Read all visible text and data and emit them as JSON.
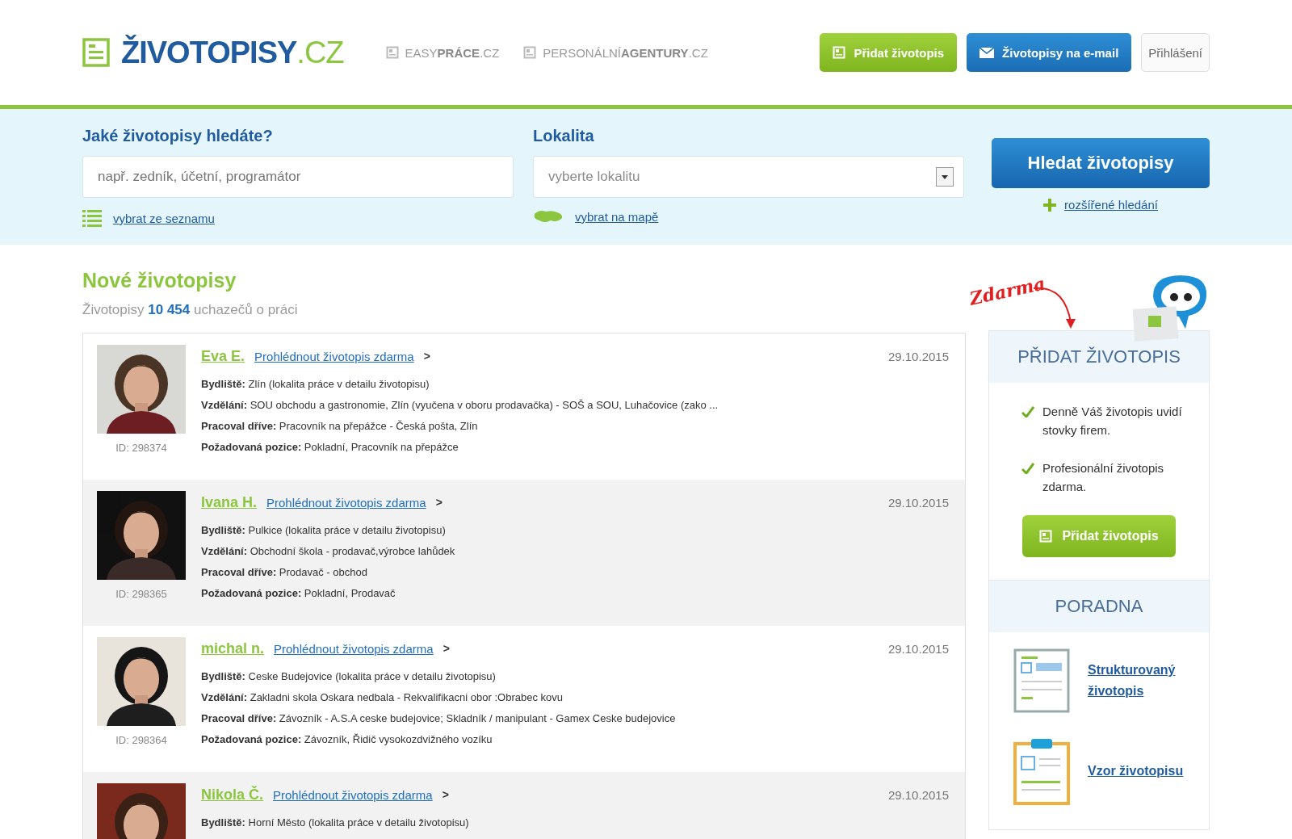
{
  "header": {
    "logo": {
      "name": "ŽIVOTOPISY",
      "suffix": ".CZ"
    },
    "partners": [
      "EASY**PRÁCE**.CZ",
      "PERSONÁLNÍ**AGENTURY**.CZ"
    ],
    "buttons": [
      {
        "label": "Přidat životopis",
        "kind": "green"
      },
      {
        "label": "Životopisy na e-mail",
        "kind": "blue"
      },
      {
        "label": "Přihlášení",
        "kind": "plain"
      }
    ]
  },
  "search": {
    "what_label": "Jaké životopisy hledáte?",
    "what_placeholder": "např. zedník, účetní, programátor",
    "list_link": "vybrat ze seznamu",
    "where_label": "Lokalita",
    "where_placeholder": "vyberte lokalitu",
    "map_link": "vybrat na mapě",
    "submit": "Hledat životopisy",
    "advanced_link": "rozšířené hledání"
  },
  "listing": {
    "title": "Nové životopisy",
    "subtitle": "Životopisy **10 454** uchazečů o práci",
    "candidates": [
      {
        "name": "Eva E.",
        "link": "Prohlédnout životopis zdarma",
        "arrow": ">",
        "date": "29.10.2015",
        "id": "ID: 298374",
        "details": [
          "**Bydliště:** Zlín (lokalita práce v detailu životopisu)",
          "**Vzdělání:** SOU obchodu a gastronomie, Zlín (vyučena v oboru prodavačka) - SOŠ a SOU, Luhačovice (zako ...",
          "**Pracoval dříve:** Pracovník na přepážce - Česká pošta, Zlín",
          "**Požadovaná pozice:** Pokladní, Pracovník na přepážce"
        ]
      },
      {
        "name": "Ivana H.",
        "link": "Prohlédnout životopis zdarma",
        "arrow": ">",
        "date": "29.10.2015",
        "id": "ID: 298365",
        "details": [
          "**Bydliště:** Pulkice (lokalita práce v detailu životopisu)",
          "**Vzdělání:** Obchodní škola - prodavač,výrobce lahůdek",
          "**Pracoval dříve:** Prodavač - obchod",
          "**Požadovaná pozice:** Pokladní, Prodavač"
        ]
      },
      {
        "name": "michal n.",
        "link": "Prohlédnout životopis zdarma",
        "arrow": ">",
        "date": "29.10.2015",
        "id": "ID: 298364",
        "details": [
          "**Bydliště:** Ceske Budejovice (lokalita práce v detailu životopisu)",
          "**Vzdělání:** Zakladni skola Oskara nedbala - Rekvalifikacni obor :Obrabec kovu",
          "**Pracoval dříve:** Závozník - A.S.A ceske budejovice; Skladník / manipulant - Gamex Ceske budejovice",
          "**Požadovaná pozice:** Závozník, Řidič vysokozdvižného vozíku"
        ]
      },
      {
        "name": "Nikola Č.",
        "link": "Prohlédnout životopis zdarma",
        "arrow": ">",
        "date": "29.10.2015",
        "details": [
          "**Bydliště:** Horní Město (lokalita práce v detailu životopisu)"
        ]
      }
    ]
  },
  "sidebar": {
    "badge": "Zdarma",
    "add_title": "PŘIDAT ŽIVOTOPIS",
    "benefits": [
      "Denně Váš životopis uvidí stovky firem.",
      "Profesionální životopis zdarma."
    ],
    "add_button": "Přidat životopis",
    "advice_title": "PORADNA",
    "advice": [
      {
        "label": "Strukturovaný životopis",
        "kind": "form"
      },
      {
        "label": "Vzor životopisu",
        "kind": "clipboard"
      }
    ]
  }
}
